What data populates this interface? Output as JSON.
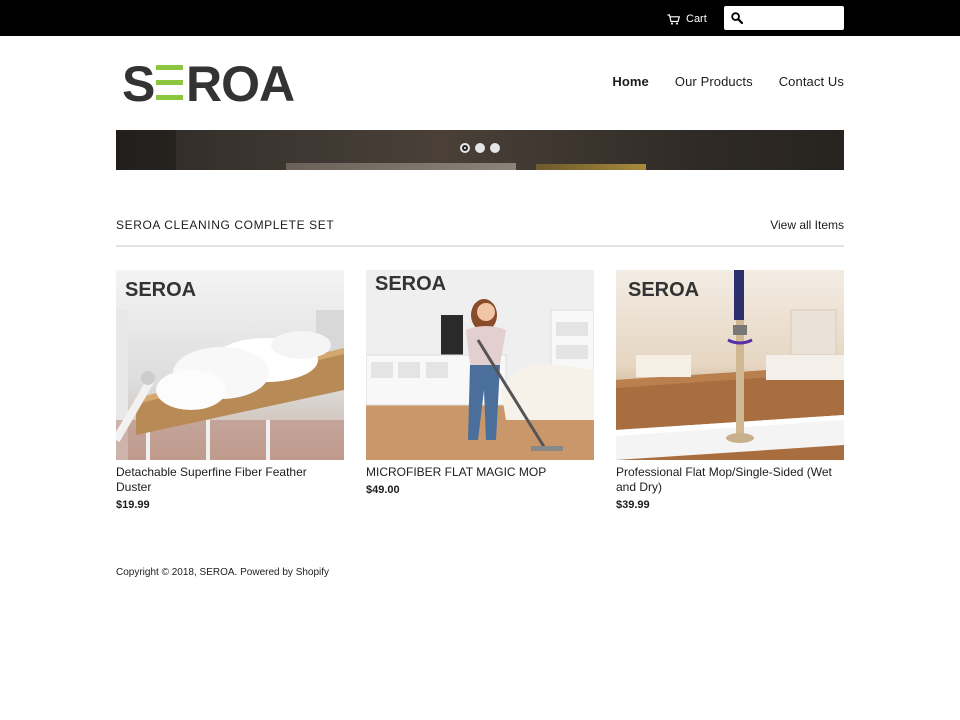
{
  "topbar": {
    "cart_label": "Cart",
    "search_placeholder": "",
    "search_value": ""
  },
  "brand": {
    "name": "SEROA",
    "logo_text_dark": "#333333",
    "logo_accent": "#8cc63f"
  },
  "nav": {
    "items": [
      {
        "label": "Home",
        "active": true
      },
      {
        "label": "Our Products",
        "active": false
      },
      {
        "label": "Contact Us",
        "active": false
      }
    ]
  },
  "slider": {
    "slide_count": 3,
    "active_index": 0
  },
  "collection": {
    "title": "SEROA CLEANING COMPLETE SET",
    "view_all_label": "View all Items"
  },
  "products": [
    {
      "title": "Detachable Superfine Fiber Feather Duster",
      "price": "$19.99",
      "image_brand": "SEROA"
    },
    {
      "title": "MICROFIBER FLAT MAGIC MOP",
      "price": "$49.00",
      "image_brand": "SEROA"
    },
    {
      "title": "Professional Flat Mop/Single-Sided (Wet and Dry)",
      "price": "$39.99",
      "image_brand": "SEROA"
    }
  ],
  "footer": {
    "copyright": "Copyright © 2018,",
    "store_link": "SEROA",
    "separator": ".",
    "powered_by": "Powered by Shopify"
  },
  "icons": {
    "cart": "cart-icon",
    "search": "search-icon"
  }
}
